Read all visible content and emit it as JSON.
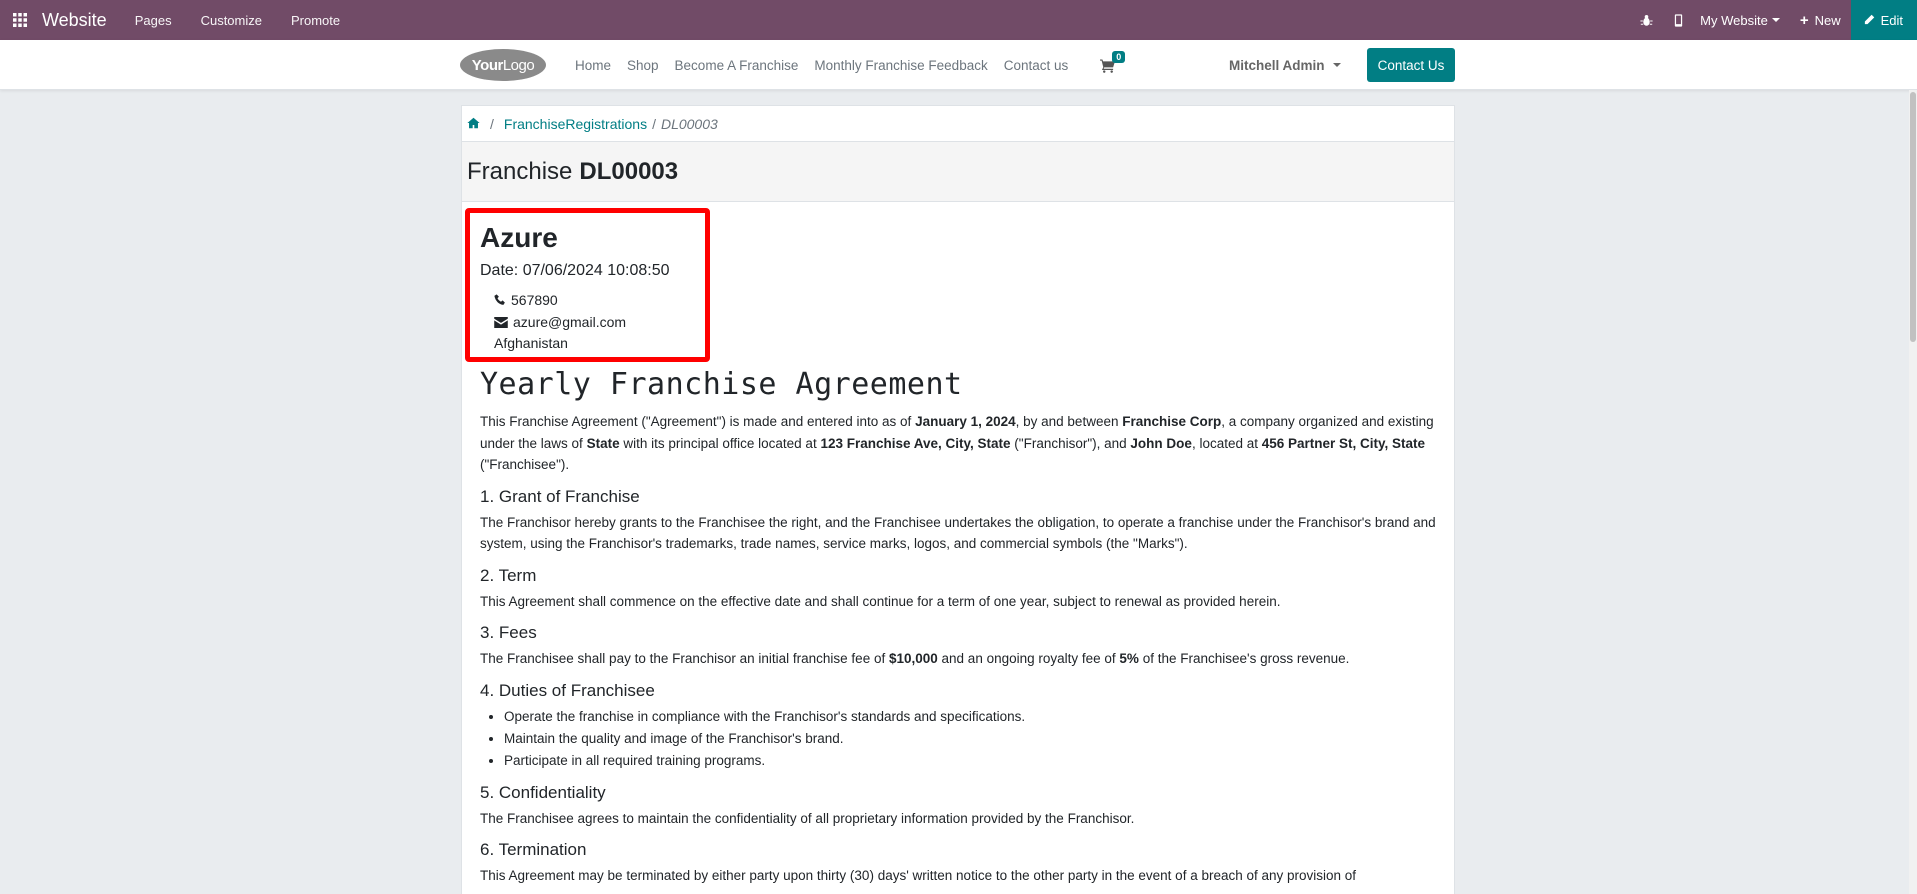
{
  "admin_bar": {
    "brand": "Website",
    "menu": [
      "Pages",
      "Customize",
      "Promote"
    ],
    "website_selector": "My Website",
    "new_label": "New",
    "edit_label": "Edit",
    "color": "#714b67",
    "edit_color": "#017e84"
  },
  "site_header": {
    "logo_text_bold": "Your",
    "logo_text_thin": "Logo",
    "nav": [
      "Home",
      "Shop",
      "Become A Franchise",
      "Monthly Franchise Feedback",
      "Contact us"
    ],
    "cart_count": "0",
    "user": "Mitchell Admin",
    "contact_button": "Contact Us"
  },
  "breadcrumb": {
    "parent": "FranchiseRegistrations",
    "separator": "/",
    "current": "DL00003"
  },
  "record": {
    "title_prefix": "Franchise",
    "code": "DL00003"
  },
  "contact": {
    "name": "Azure",
    "date": "Date: 07/06/2024 10:08:50",
    "phone": "567890",
    "email": "azure@gmail.com",
    "country": "Afghanistan"
  },
  "agreement": {
    "title": "Yearly Franchise Agreement",
    "intro": {
      "t1": "This Franchise Agreement (\"Agreement\") is made and entered into as of ",
      "b1": "January 1, 2024",
      "t2": ", by and between ",
      "b2": "Franchise Corp",
      "t3": ", a company organized and existing under the laws of ",
      "b3": "State",
      "t4": " with its principal office located at ",
      "b4": "123 Franchise Ave, City, State",
      "t5": " (\"Franchisor\"), and ",
      "b5": "John Doe",
      "t6": ", located at ",
      "b6": "456 Partner St, City, State",
      "t7": " (\"Franchisee\")."
    },
    "s1_title": "1. Grant of Franchise",
    "s1_text": "The Franchisor hereby grants to the Franchisee the right, and the Franchisee undertakes the obligation, to operate a franchise under the Franchisor's brand and system, using the Franchisor's trademarks, trade names, service marks, logos, and commercial symbols (the \"Marks\").",
    "s2_title": "2. Term",
    "s2_text": "This Agreement shall commence on the effective date and shall continue for a term of one year, subject to renewal as provided herein.",
    "s3_title": "3. Fees",
    "s3": {
      "t1": "The Franchisee shall pay to the Franchisor an initial franchise fee of ",
      "b1": "$10,000",
      "t2": " and an ongoing royalty fee of ",
      "b2": "5%",
      "t3": " of the Franchisee's gross revenue."
    },
    "s4_title": "4. Duties of Franchisee",
    "s4_items": [
      "Operate the franchise in compliance with the Franchisor's standards and specifications.",
      "Maintain the quality and image of the Franchisor's brand.",
      "Participate in all required training programs."
    ],
    "s5_title": "5. Confidentiality",
    "s5_text": "The Franchisee agrees to maintain the confidentiality of all proprietary information provided by the Franchisor.",
    "s6_title": "6. Termination",
    "s6_text": "This Agreement may be terminated by either party upon thirty (30) days' written notice to the other party in the event of a breach of any provision of"
  }
}
